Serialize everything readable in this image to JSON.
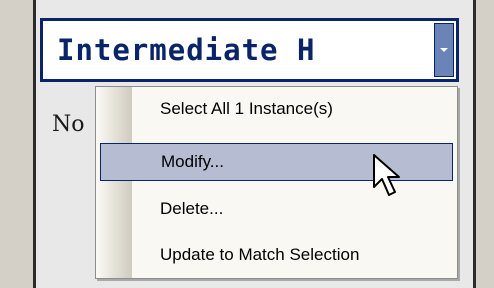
{
  "style_dropdown": {
    "value": "Intermediate H"
  },
  "partial_label": "No",
  "context_menu": {
    "items": [
      {
        "label": "Select All 1 Instance(s)",
        "highlighted": false
      },
      {
        "label": "Modify...",
        "highlighted": true
      },
      {
        "label": "Delete...",
        "highlighted": false
      },
      {
        "label": "Update to Match Selection",
        "highlighted": false
      }
    ]
  },
  "colors": {
    "accent": "#0a246a",
    "highlight": "#b6bdd2"
  },
  "icons": {
    "dropdown": "chevron-down-icon",
    "cursor": "mouse-pointer-icon"
  }
}
